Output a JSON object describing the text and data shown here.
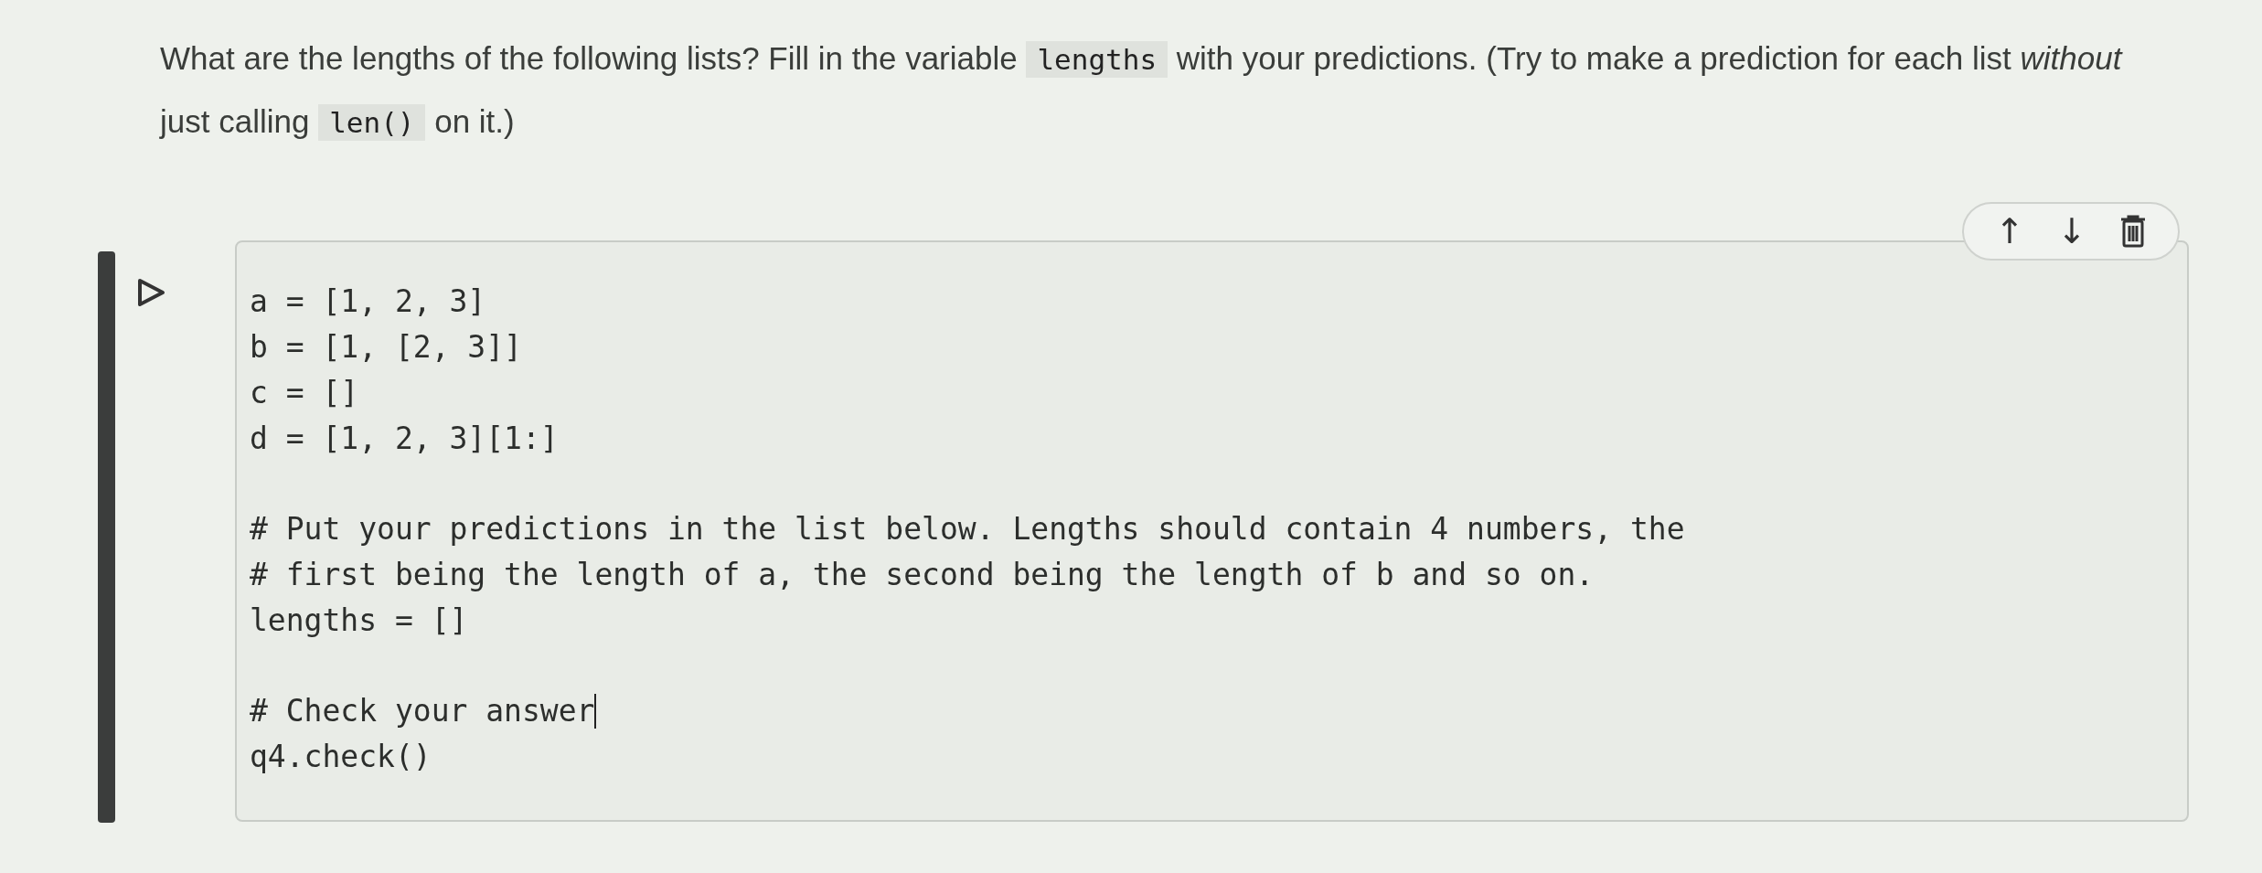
{
  "markdown_cell": {
    "segments": [
      {
        "kind": "text",
        "text": "What are the lengths of the following lists? Fill in the variable "
      },
      {
        "kind": "code",
        "text": "lengths"
      },
      {
        "kind": "text",
        "text": " with your predictions. (Try to make a prediction for each list *without* just calling "
      },
      {
        "kind": "code",
        "text": "len()"
      },
      {
        "kind": "text",
        "text": " on it.)"
      }
    ]
  },
  "code_cell": {
    "selected": true,
    "toolbar": [
      "↑",
      "↓"
    ],
    "lines": [
      {
        "text": "a = [1, 2, 3]",
        "cursor": false
      },
      {
        "text": "b = [1, [2, 3]]",
        "cursor": false
      },
      {
        "text": "c = []",
        "cursor": false
      },
      {
        "text": "d = [1, 2, 3][1:]",
        "cursor": false
      },
      {
        "cursor": false
      },
      {
        "text": "# Put your predictions in the list below. Lengths should contain 4 numbers, the",
        "cursor": false
      },
      {
        "text": "# first being the length of a, the second being the length of b and so on.",
        "cursor": false
      },
      {
        "text": "lengths = []",
        "cursor": false
      },
      {
        "cursor": false
      },
      {
        "text": "# Check your answer",
        "cursor": true
      },
      {
        "text": "q4.check()",
        "cursor": false
      }
    ]
  }
}
